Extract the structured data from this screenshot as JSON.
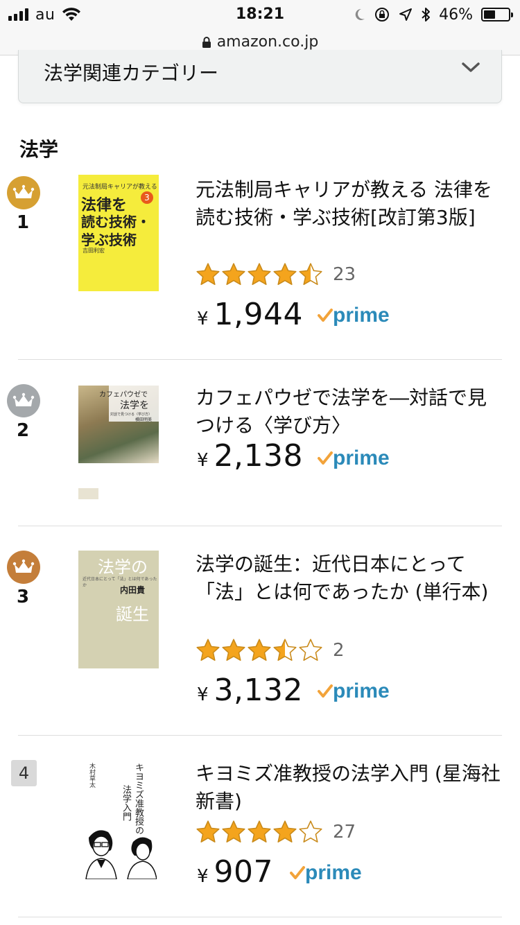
{
  "status_bar": {
    "carrier": "au",
    "time": "18:21",
    "battery_percent": "46%",
    "battery_level": 0.46
  },
  "url_bar": {
    "domain": "amazon.co.jp"
  },
  "category_select": {
    "label": "法学関連カテゴリー"
  },
  "section": {
    "heading": "法学"
  },
  "items": [
    {
      "rank": "1",
      "badge": "gold",
      "title": "元法制局キャリアが教える 法律を読む技術・学ぶ技術[改訂第3版]",
      "rating": 4.5,
      "review_count": "23",
      "yen": "¥",
      "price": "1,944",
      "prime": "prime",
      "cover": {
        "top": "元法制局キャリアが教える",
        "main1": "法律を",
        "main2": "読む技術・",
        "main3": "学ぶ技術",
        "edition": "3",
        "author": "吉田利宏"
      }
    },
    {
      "rank": "2",
      "badge": "silver",
      "title": "カフェパウゼで法学を―対話で見つける〈学び方〉",
      "rating": null,
      "review_count": "",
      "yen": "¥",
      "price": "2,138",
      "prime": "prime",
      "cover": {
        "main1": "カフェパウゼで",
        "main2": "法学を",
        "sub": "対話で見つける〈学び方〉",
        "author": "横田明美"
      }
    },
    {
      "rank": "3",
      "badge": "bronze",
      "title": "法学の誕生：近代日本にとって「法」とは何であったか (単行本)",
      "rating": 3.5,
      "review_count": "2",
      "yen": "¥",
      "price": "3,132",
      "prime": "prime",
      "cover": {
        "main1": "法学の",
        "sub": "近代日本にとって「法」とは何であったか",
        "author": "内田貴",
        "main2": "誕生"
      }
    },
    {
      "rank": "4",
      "badge": "box",
      "title": "キヨミズ准教授の法学入門 (星海社新書)",
      "rating": 4,
      "review_count": "27",
      "yen": "¥",
      "price": "907",
      "prime": "prime",
      "cover": {
        "main1": "キヨミズ准教授の",
        "main2": "法学入門",
        "author": "木村草太"
      }
    }
  ],
  "colors": {
    "gold": "#d6a032",
    "silver": "#a4a8ab",
    "bronze": "#c47e3a",
    "star": "#f4a41d",
    "prime_blue": "#2b8ab9",
    "prime_check": "#f2a33a"
  }
}
